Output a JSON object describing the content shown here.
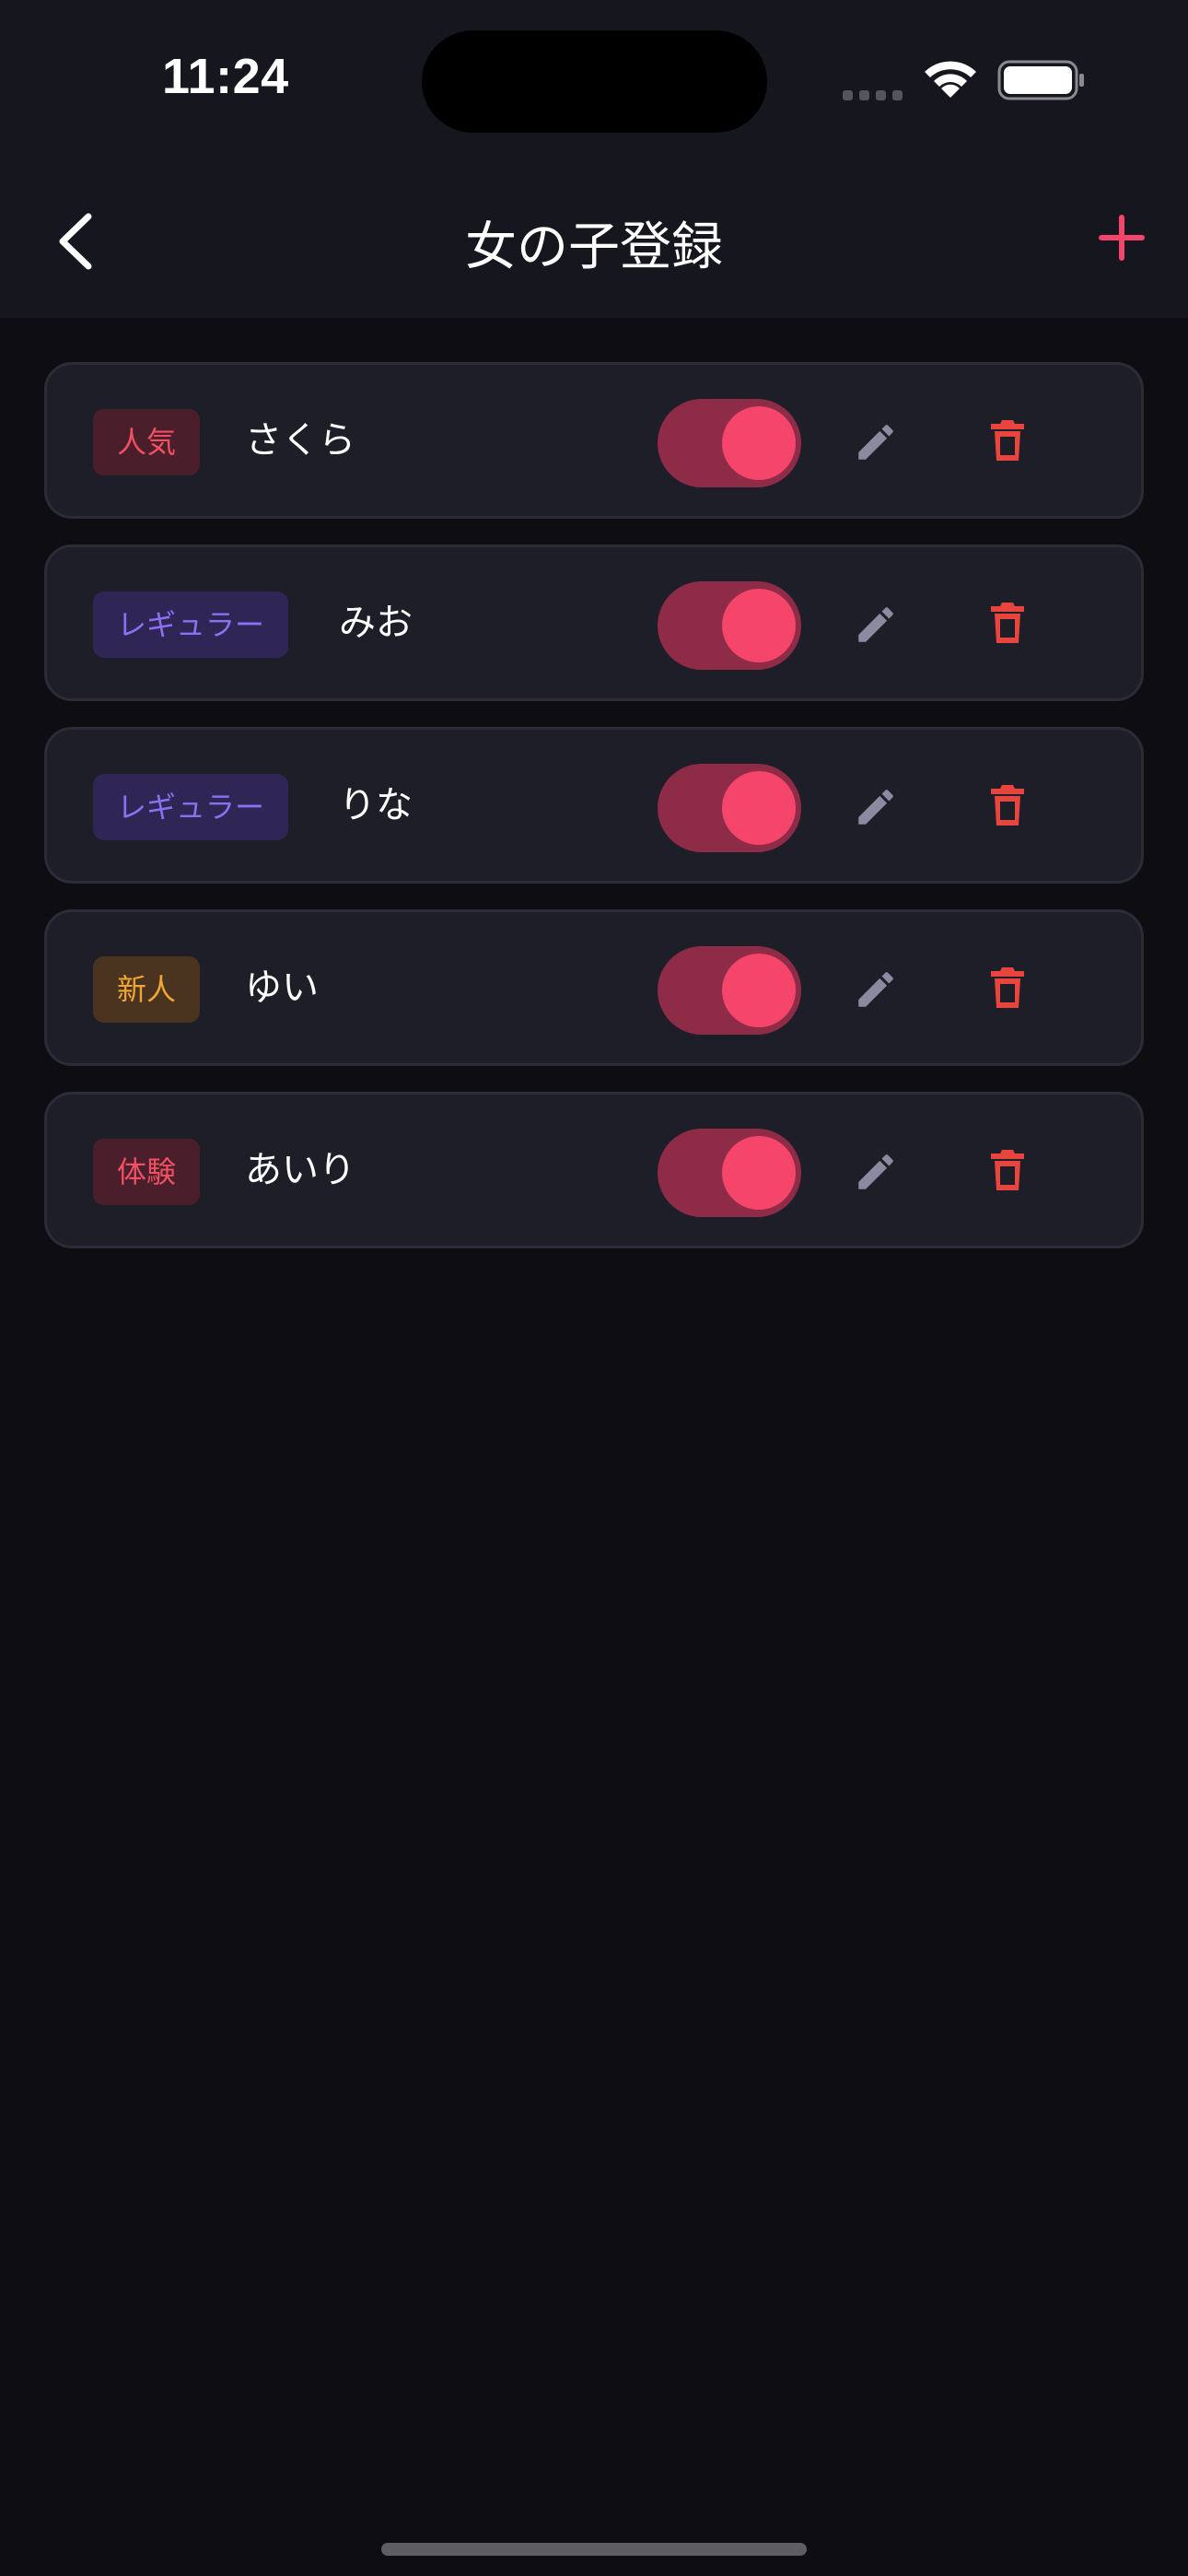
{
  "status_bar": {
    "time": "11:24"
  },
  "nav": {
    "title": "女の子登録"
  },
  "colors": {
    "accent": "#f5456a",
    "toggle_track": "#8e2c48",
    "edit_icon": "#8a8aa0",
    "delete_icon": "#e8453f"
  },
  "girls": [
    {
      "category": "人気",
      "name": "さくら",
      "enabled": true
    },
    {
      "category": "レギュラー",
      "name": "みお",
      "enabled": true
    },
    {
      "category": "レギュラー",
      "name": "りな",
      "enabled": true
    },
    {
      "category": "新人",
      "name": "ゆい",
      "enabled": true
    },
    {
      "category": "体験",
      "name": "あいり",
      "enabled": true
    }
  ]
}
